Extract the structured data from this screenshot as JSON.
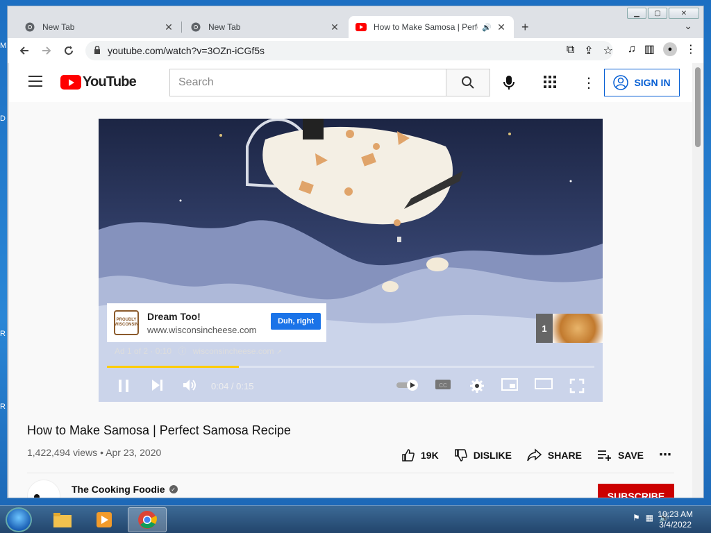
{
  "browser": {
    "tabs": [
      {
        "label": "New Tab",
        "active": false
      },
      {
        "label": "New Tab",
        "active": false
      },
      {
        "label": "How to Make Samosa | Perfe",
        "active": true
      }
    ],
    "url": "youtube.com/watch?v=3OZn-iCGf5s"
  },
  "youtube": {
    "logo_text": "YouTube",
    "search_placeholder": "Search",
    "sign_in": "SIGN IN"
  },
  "player": {
    "ad": {
      "title": "Dream Too!",
      "url": "www.wisconsincheese.com",
      "cta": "Duh, right",
      "logo_text": "PROUDLY WISCONSIN",
      "meta": "Ad 1 of 2 · 0:10",
      "meta_domain": "wisconsincheese.com",
      "next_number": "1"
    },
    "time": "0:04 / 0:15",
    "progress_fraction": 0.27,
    "progress_color": "#ffcc00"
  },
  "video": {
    "title": "How to Make Samosa | Perfect Samosa Recipe",
    "views": "1,422,494 views",
    "date": "Apr 23, 2020",
    "likes": "19K",
    "dislike": "DISLIKE",
    "share": "SHARE",
    "save": "SAVE",
    "channel": "The Cooking Foodie",
    "subscribe": "SUBSCRIBE"
  },
  "taskbar": {
    "time": "10:23 AM",
    "date": "3/4/2022"
  }
}
